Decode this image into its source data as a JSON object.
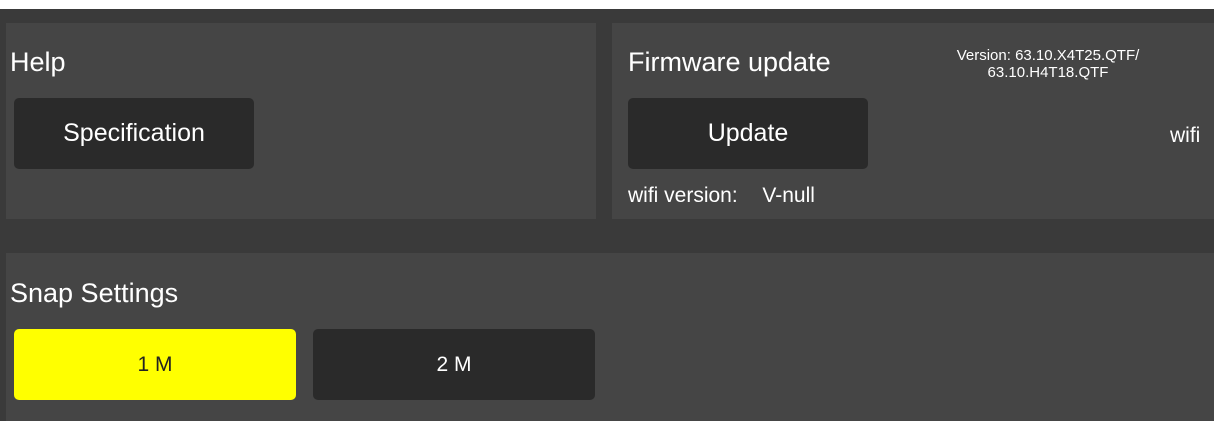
{
  "help": {
    "title": "Help",
    "specification_label": "Specification"
  },
  "firmware": {
    "title": "Firmware update",
    "version_line1": "Version: 63.10.X4T25.QTF/",
    "version_line2": "63.10.H4T18.QTF",
    "update_label": "Update",
    "wifi_label": "wifi version:",
    "wifi_value": "V-null",
    "wifi_cut_label": "wifi"
  },
  "snap": {
    "title": "Snap Settings",
    "options": [
      {
        "label": "1 M",
        "selected": true
      },
      {
        "label": "2 M",
        "selected": false
      }
    ]
  },
  "colors": {
    "background": "#3a3a3a",
    "panel": "#454545",
    "button": "#2a2a2a",
    "selected": "#ffff00"
  }
}
